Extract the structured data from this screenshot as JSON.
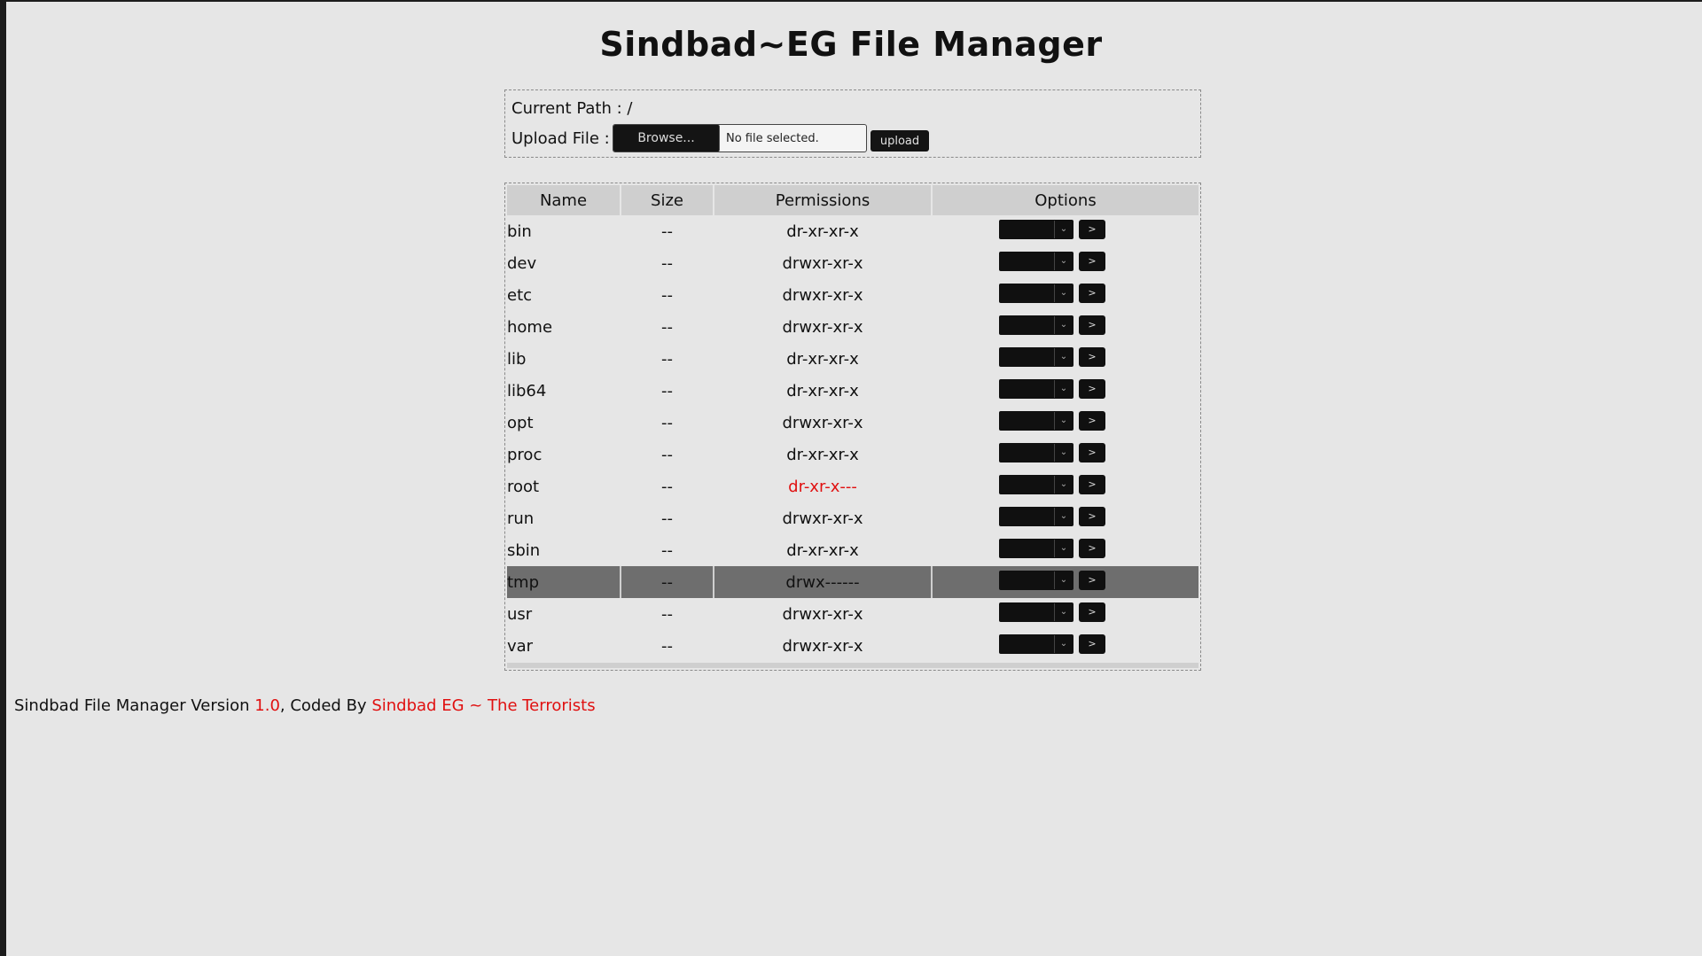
{
  "app": {
    "title": "Sindbad~EG File Manager"
  },
  "info": {
    "path_label": "Current Path :",
    "path_value": "/",
    "upload_label": "Upload File :",
    "browse_label": "Browse...",
    "no_file_text": "No file selected.",
    "upload_button": "upload"
  },
  "table": {
    "headers": [
      "Name",
      "Size",
      "Permissions",
      "Options"
    ],
    "rows": [
      {
        "name": "bin",
        "size": "--",
        "perm": "dr-xr-xr-x",
        "perm_color": "default"
      },
      {
        "name": "dev",
        "size": "--",
        "perm": "drwxr-xr-x",
        "perm_color": "default"
      },
      {
        "name": "etc",
        "size": "--",
        "perm": "drwxr-xr-x",
        "perm_color": "default"
      },
      {
        "name": "home",
        "size": "--",
        "perm": "drwxr-xr-x",
        "perm_color": "default"
      },
      {
        "name": "lib",
        "size": "--",
        "perm": "dr-xr-xr-x",
        "perm_color": "default"
      },
      {
        "name": "lib64",
        "size": "--",
        "perm": "dr-xr-xr-x",
        "perm_color": "default"
      },
      {
        "name": "opt",
        "size": "--",
        "perm": "drwxr-xr-x",
        "perm_color": "default"
      },
      {
        "name": "proc",
        "size": "--",
        "perm": "dr-xr-xr-x",
        "perm_color": "default"
      },
      {
        "name": "root",
        "size": "--",
        "perm": "dr-xr-x---",
        "perm_color": "red"
      },
      {
        "name": "run",
        "size": "--",
        "perm": "drwxr-xr-x",
        "perm_color": "default"
      },
      {
        "name": "sbin",
        "size": "--",
        "perm": "dr-xr-xr-x",
        "perm_color": "default"
      },
      {
        "name": "tmp",
        "size": "--",
        "perm": "drwx------",
        "perm_color": "green",
        "selected": true
      },
      {
        "name": "usr",
        "size": "--",
        "perm": "drwxr-xr-x",
        "perm_color": "default"
      },
      {
        "name": "var",
        "size": "--",
        "perm": "drwxr-xr-x",
        "perm_color": "default"
      }
    ],
    "go_button_label": ">"
  },
  "footer": {
    "prefix": "Sindbad File Manager Version",
    "version": "1.0",
    "coded_by": ", Coded By",
    "author": "Sindbad EG ~ The Terrorists"
  },
  "colors": {
    "background": "#e6e6e6",
    "accent_red": "#e01010",
    "accent_green": "#1f8a1f",
    "selected_row": "#6e6e6e"
  },
  "icons": {
    "select_dropdown": "chevron-down-icon"
  }
}
